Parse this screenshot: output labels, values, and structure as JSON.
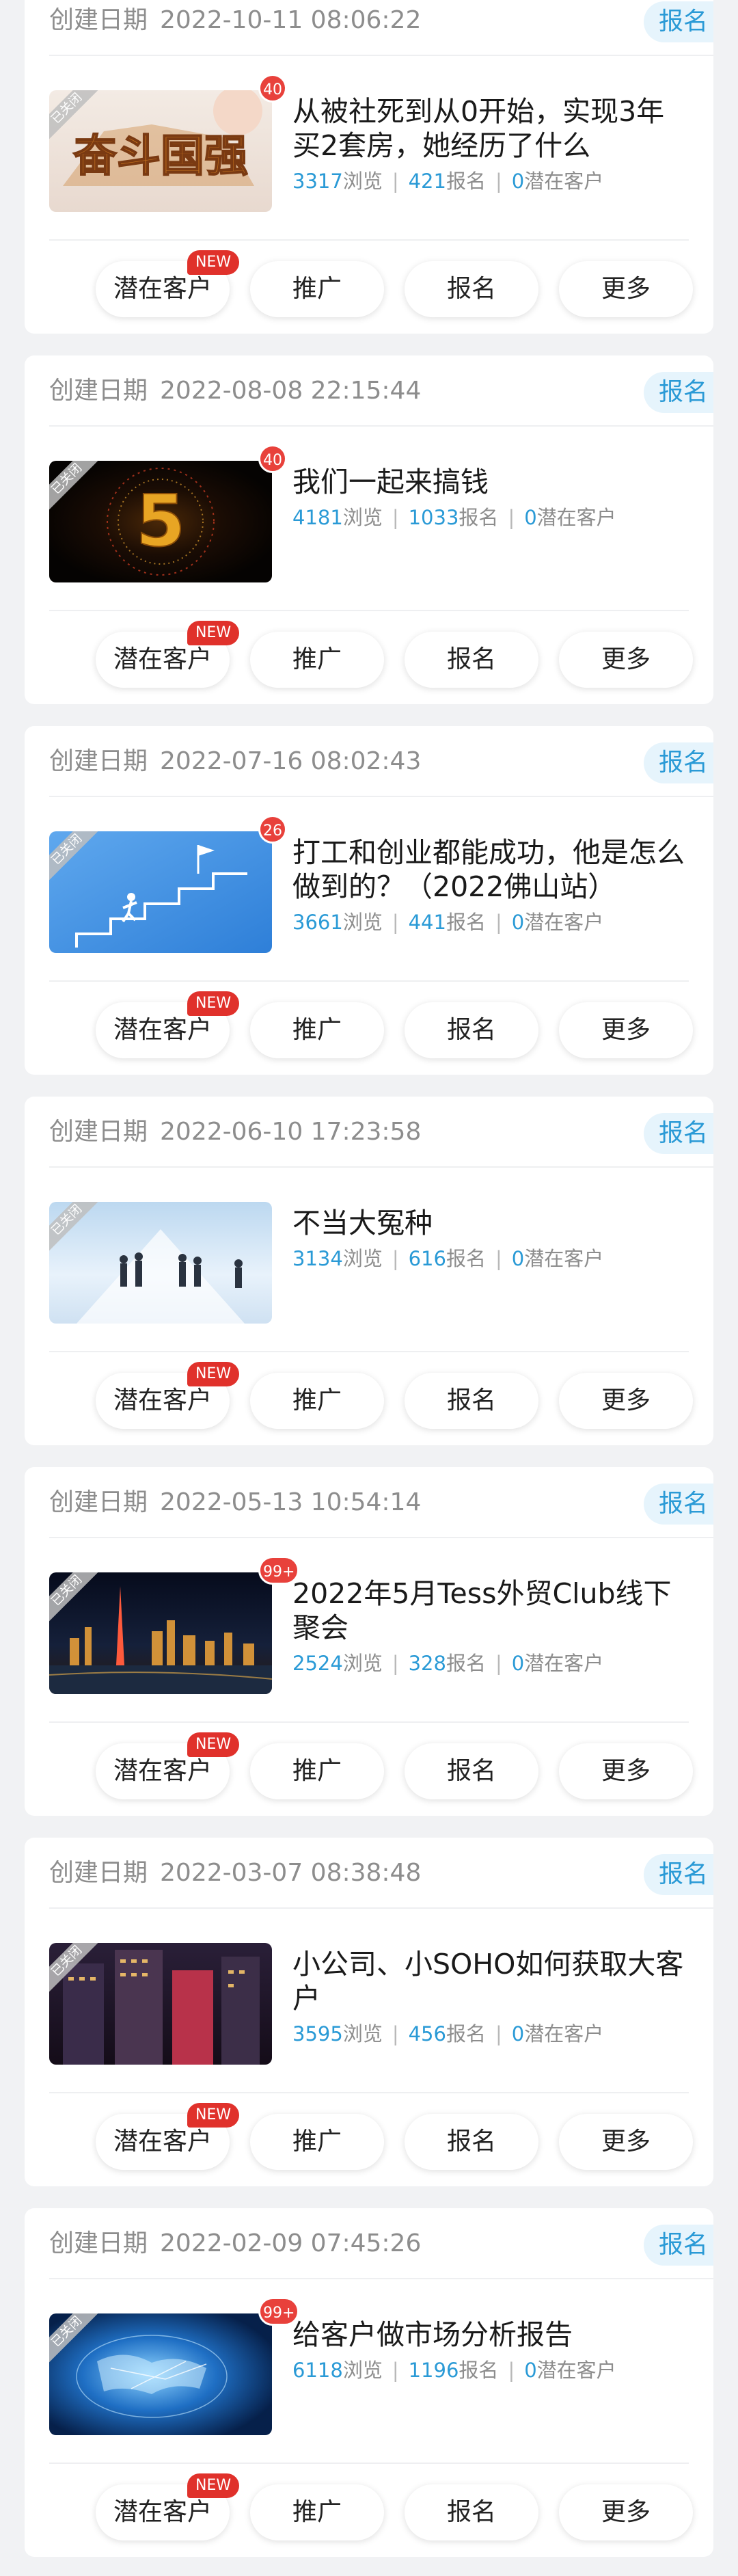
{
  "common": {
    "created_label": "创建日期",
    "type_tag": "报名",
    "closed_ribbon": "已关闭",
    "stats_units": {
      "views": "浏览",
      "signups": "报名",
      "leads": "潜在客户"
    },
    "buttons": {
      "leads": "潜在客户",
      "promote": "推广",
      "signup": "报名",
      "more": "更多"
    },
    "new_badge": "NEW"
  },
  "events": [
    {
      "date": "2022-10-11 08:06:22",
      "title": "从被社死到从0开始，实现3年买2套房，她经历了什么",
      "badge": "40",
      "views": "3317",
      "signups": "421",
      "leads": "0",
      "thumb_text": "奋斗国强"
    },
    {
      "date": "2022-08-08 22:15:44",
      "title": "我们一起来搞钱",
      "badge": "40",
      "views": "4181",
      "signups": "1033",
      "leads": "0",
      "thumb_text": "5"
    },
    {
      "date": "2022-07-16 08:02:43",
      "title": "打工和创业都能成功，他是怎么做到的？（2022佛山站）",
      "badge": "26",
      "views": "3661",
      "signups": "441",
      "leads": "0"
    },
    {
      "date": "2022-06-10 17:23:58",
      "title": "不当大冤种",
      "badge": "",
      "views": "3134",
      "signups": "616",
      "leads": "0"
    },
    {
      "date": "2022-05-13 10:54:14",
      "title": "2022年5月Tess外贸Club线下聚会",
      "badge": "99+",
      "views": "2524",
      "signups": "328",
      "leads": "0"
    },
    {
      "date": "2022-03-07 08:38:48",
      "title": "小公司、小SOHO如何获取大客户",
      "badge": "",
      "views": "3595",
      "signups": "456",
      "leads": "0"
    },
    {
      "date": "2022-02-09 07:45:26",
      "title": "给客户做市场分析报告",
      "badge": "99+",
      "views": "6118",
      "signups": "1196",
      "leads": "0"
    }
  ]
}
